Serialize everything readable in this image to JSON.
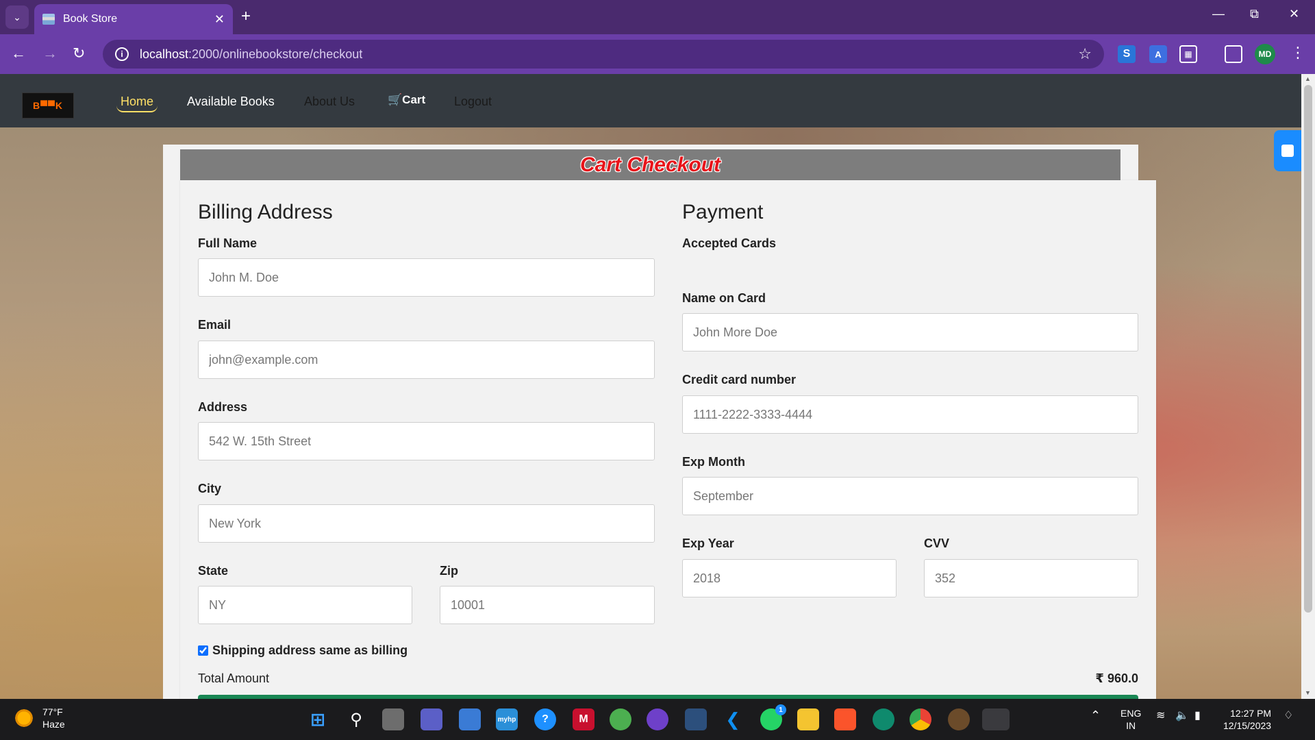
{
  "browser": {
    "tab_title": "Book Store",
    "url_host": "localhost",
    "url_path": ":2000/onlinebookstore/checkout",
    "profile_initials": "MD"
  },
  "site": {
    "logo_text": "B▀▀K",
    "nav": {
      "home": "Home",
      "available_books": "Available Books",
      "about_us": "About Us",
      "cart": "Cart",
      "logout": "Logout"
    }
  },
  "checkout": {
    "title": "Cart Checkout",
    "billing": {
      "heading": "Billing Address",
      "full_name_label": "Full Name",
      "full_name_placeholder": "John M. Doe",
      "email_label": "Email",
      "email_placeholder": "john@example.com",
      "address_label": "Address",
      "address_placeholder": "542 W. 15th Street",
      "city_label": "City",
      "city_placeholder": "New York",
      "state_label": "State",
      "state_placeholder": "NY",
      "zip_label": "Zip",
      "zip_placeholder": "10001"
    },
    "payment": {
      "heading": "Payment",
      "accepted_cards_label": "Accepted Cards",
      "name_on_card_label": "Name on Card",
      "name_on_card_placeholder": "John More Doe",
      "card_number_label": "Credit card number",
      "card_number_placeholder": "1111-2222-3333-4444",
      "exp_month_label": "Exp Month",
      "exp_month_placeholder": "September",
      "exp_year_label": "Exp Year",
      "exp_year_placeholder": "2018",
      "cvv_label": "CVV",
      "cvv_placeholder": "352"
    },
    "shipping_same_label": "Shipping address same as billing",
    "shipping_same_checked": true,
    "total_label": "Total Amount",
    "total_value": "₹ 960.0"
  },
  "taskbar": {
    "weather_temp": "77°F",
    "weather_desc": "Haze",
    "lang_line1": "ENG",
    "lang_line2": "IN",
    "time": "12:27 PM",
    "date": "12/15/2023",
    "whatsapp_badge": "1"
  },
  "colors": {
    "nav_bg": "#343a40",
    "active_link": "#ffe066",
    "title_red": "#e8141a",
    "pay_button": "#198754"
  }
}
